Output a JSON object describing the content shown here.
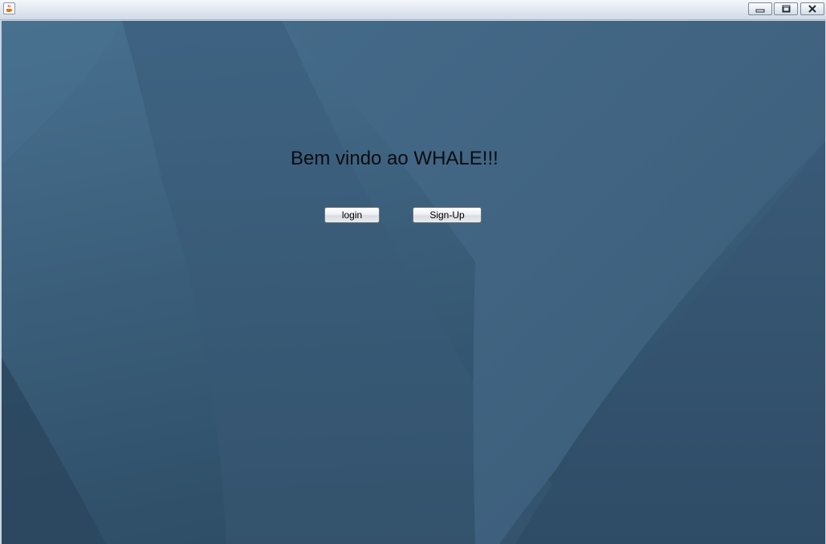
{
  "window": {
    "title": "",
    "icons": {
      "app": "java-coffee-cup-icon",
      "minimize": "minimize-icon",
      "maximize": "maximize-icon",
      "close": "close-icon"
    }
  },
  "main": {
    "welcome_text": "Bem vindo ao WHALE!!!",
    "login_label": "login",
    "signup_label": "Sign-Up"
  },
  "colors": {
    "background": "#3d5f7d",
    "titlebar": "#dfe6ef",
    "text": "#0b0d10"
  }
}
